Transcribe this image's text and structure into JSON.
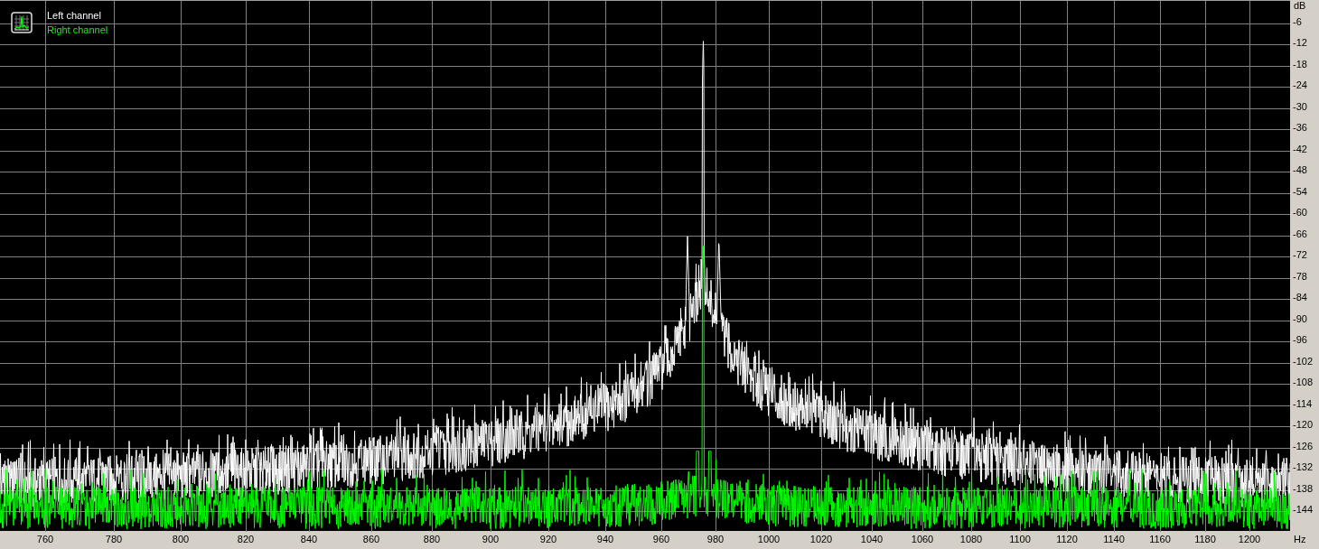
{
  "legend": [
    {
      "label": "Left channel",
      "color": "#ffffff"
    },
    {
      "label": "Right channel",
      "color": "#00ff00"
    }
  ],
  "y_axis": {
    "unit": "dB",
    "ticks": [
      "-6",
      "-12",
      "-18",
      "-24",
      "-30",
      "-36",
      "-42",
      "-48",
      "-54",
      "-60",
      "-66",
      "-72",
      "-78",
      "-84",
      "-90",
      "-96",
      "-102",
      "-108",
      "-114",
      "-120",
      "-126",
      "-132",
      "-138",
      "-144"
    ]
  },
  "x_axis": {
    "unit": "Hz",
    "ticks": [
      "760",
      "780",
      "800",
      "820",
      "840",
      "860",
      "880",
      "900",
      "920",
      "940",
      "960",
      "980",
      "1000",
      "1020",
      "1040",
      "1060",
      "1080",
      "1100",
      "1120",
      "1140",
      "1160",
      "1180",
      "1200"
    ]
  }
}
